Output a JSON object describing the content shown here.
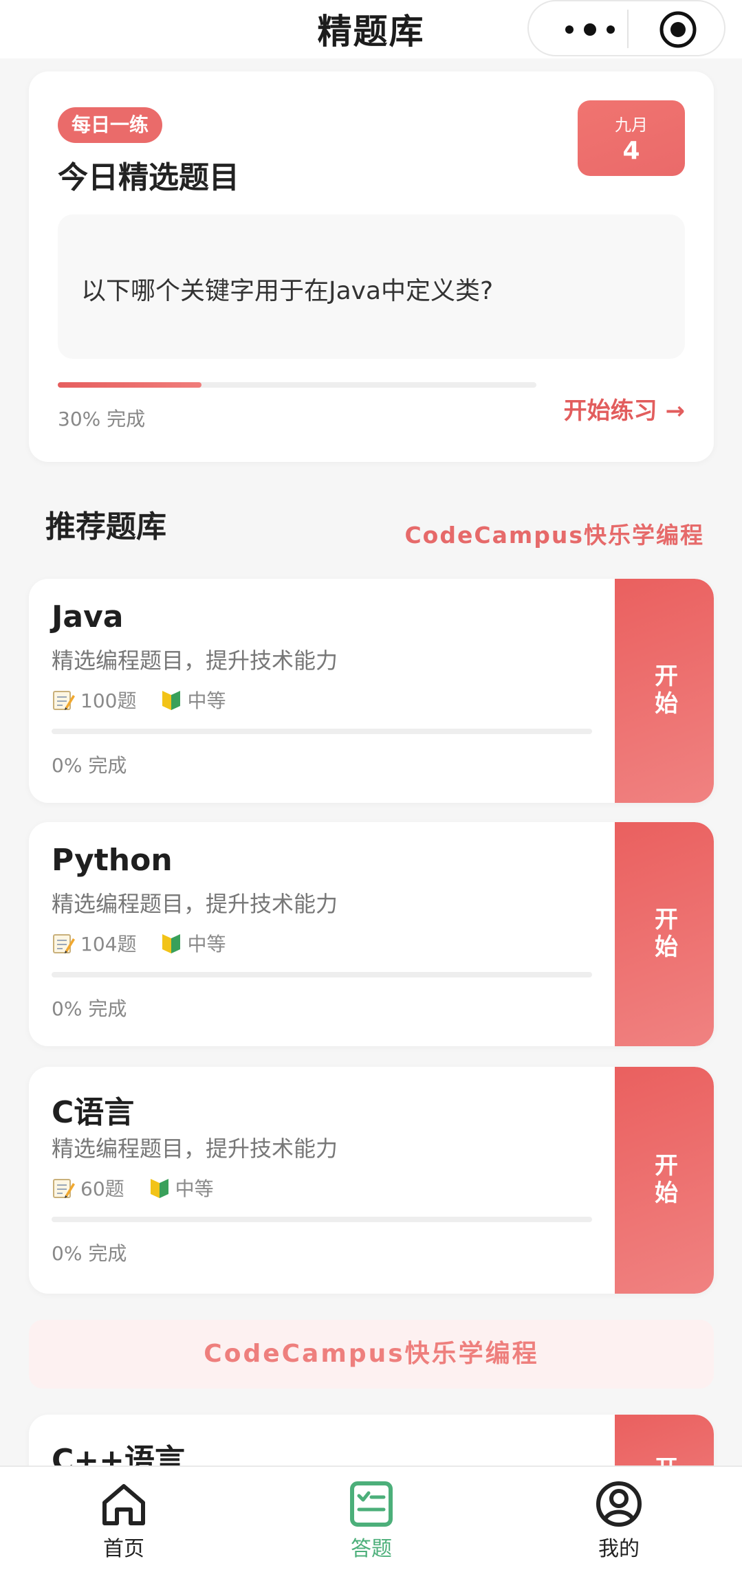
{
  "header": {
    "title": "精题库"
  },
  "daily": {
    "badge": "每日一练",
    "title": "今日精选题目",
    "date_month": "九月",
    "date_day": "4",
    "question": "以下哪个关键字用于在Java中定义类?",
    "progress_fraction": 0.3,
    "progress_text": "30% 完成",
    "start_label": "开始练习 →"
  },
  "section": {
    "title": "推荐题库",
    "tag": "CodeCampus快乐学编程"
  },
  "banks": [
    {
      "name": "Java",
      "desc": "精选编程题目，提升技术能力",
      "count": "100题",
      "level": "中等",
      "progress_fraction": 0,
      "progress_text": "0% 完成",
      "start_label": "开始"
    },
    {
      "name": "Python",
      "desc": "精选编程题目，提升技术能力",
      "count": "104题",
      "level": "中等",
      "progress_fraction": 0,
      "progress_text": "0% 完成",
      "start_label": "开始"
    },
    {
      "name": "C语言",
      "desc": "精选编程题目，提升技术能力",
      "count": "60题",
      "level": "中等",
      "progress_fraction": 0,
      "progress_text": "0% 完成",
      "start_label": "开始"
    },
    {
      "name": "C++语言",
      "start_label": "开始"
    }
  ],
  "banner": {
    "text": "CodeCampus快乐学编程"
  },
  "tabs": [
    {
      "label": "首页",
      "icon": "home-icon"
    },
    {
      "label": "答题",
      "icon": "quiz-icon",
      "active": true
    },
    {
      "label": "我的",
      "icon": "profile-icon"
    }
  ],
  "colors": {
    "accent": "#ea6b6a",
    "tab_active": "#4caf7a"
  }
}
